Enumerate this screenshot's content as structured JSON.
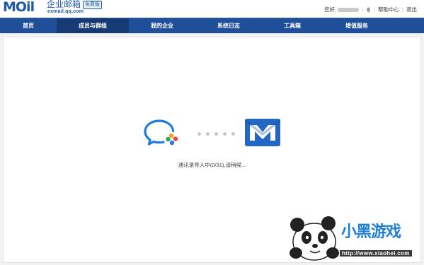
{
  "logo": {
    "brand": "MOil",
    "product": "企业邮箱",
    "badge": "免费版",
    "domain": "exmail.qq.com"
  },
  "top_links": {
    "greeting": "您好,",
    "help": "帮助中心",
    "logout": "退出"
  },
  "nav": {
    "items": [
      {
        "label": "首页",
        "active": false
      },
      {
        "label": "成员与群组",
        "active": true
      },
      {
        "label": "我的企业",
        "active": false
      },
      {
        "label": "系统日志",
        "active": false
      },
      {
        "label": "工具箱",
        "active": false
      },
      {
        "label": "增值服务",
        "active": false
      }
    ]
  },
  "main": {
    "status": "通讯录导入中(0/31),请稍候..."
  },
  "watermark": {
    "text": "小黑游戏",
    "url": "http://www.xiaohei.com"
  },
  "colors": {
    "nav_bg": "#1f4f99",
    "nav_active": "#163a74",
    "brand_blue": "#1f5aa6",
    "chat_blue": "#1e7be0",
    "mail_blue": "#2268c4"
  },
  "icons": {
    "source": "wework-chat-icon",
    "target": "exmail-icon",
    "bell": "bell-icon"
  }
}
